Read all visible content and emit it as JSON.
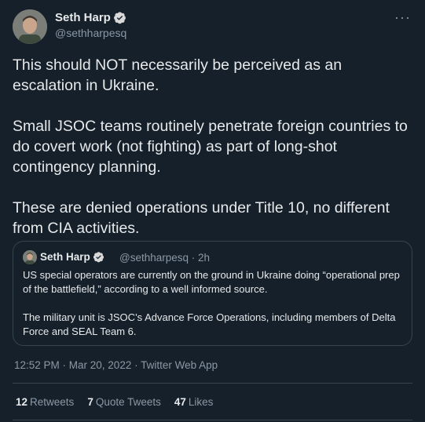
{
  "author": {
    "name": "Seth Harp",
    "handle": "@sethharpesq"
  },
  "tweet": {
    "text": "This should NOT necessarily be perceived as an escalation in Ukraine.\n\nSmall JSOC teams routinely penetrate foreign countries to do covert work (not fighting) as part of long-shot contingency planning.\n\nThese are denied operations under Title 10, no different from CIA activities.",
    "timestamp": "12:52 PM · Mar 20, 2022 · Twitter Web App"
  },
  "quoted_tweet": {
    "name": "Seth Harp",
    "meta": "@sethharpesq · 2h",
    "text": "US special operators are currently on the ground in Ukraine doing “operational prep of the battlefield,” according to a well informed source.\n\nThe military unit is JSOC’s Advance Force Operations, including members of Delta Force and SEAL Team 6."
  },
  "stats": {
    "retweets_count": "12",
    "retweets_label": "Retweets",
    "quote_count": "7",
    "quote_label": "Quote Tweets",
    "likes_count": "47",
    "likes_label": "Likes"
  },
  "icons": {
    "verified": "verified-badge-icon",
    "more": "more-options-icon"
  },
  "colors": {
    "background": "#15202b",
    "text": "#e7e9ea",
    "secondary": "#8b98a5",
    "verified": "#d9d9d9",
    "border": "#38444d"
  }
}
